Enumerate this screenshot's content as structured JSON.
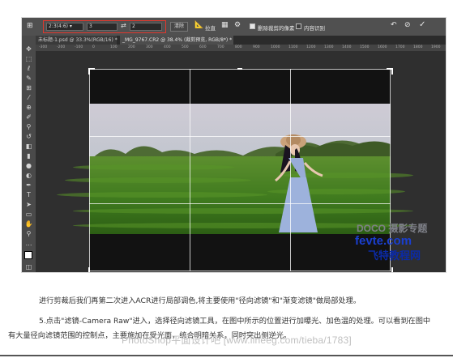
{
  "options_bar": {
    "ratio_label": "2:3(4:6)",
    "ratio_w": "3",
    "swap_symbol": "⇄",
    "ratio_h": "2",
    "clear_label": "清除",
    "straighten_label": "拉直",
    "delete_pixels_label": "删除裁剪的像素",
    "content_aware_label": "内容识别"
  },
  "tabs": [
    {
      "label": "未标题-1.psd @ 33.3%(RGB/16) *"
    },
    {
      "label": "_MG_9767.CR2 @ 38.4% (裁剪预览, RGB/8*) *"
    }
  ],
  "ruler_ticks": [
    "-300",
    "-200",
    "-100",
    "0",
    "100",
    "200",
    "300",
    "400",
    "500",
    "600",
    "700",
    "800",
    "900",
    "1000",
    "1100",
    "1200",
    "1300",
    "1400",
    "1500",
    "1600",
    "1700",
    "1800",
    "1900"
  ],
  "watermark": {
    "line1": "DOCO 摄影专题",
    "line2": "fevte.com",
    "line3": "飞特教程网"
  },
  "article": {
    "p1": "进行剪裁后我们再第二次进入ACR进行局部调色,将主要使用\"径向滤镜\"和\"渐变滤镜\"做局部处理。",
    "p2": "5.点击\"滤镜-Camera Raw\"进入，选择径向滤镜工具，在图中所示的位置进行加曝光、加色温的处理。可以看到在图中",
    "p3": "有大量径向滤镜范围的控制点，主要施加在受光面，统合明暗关系，同时突出侧逆光。",
    "footer_watermark": "PhotoShop平面设计吧 [www.lineeg.com/tieba/1783]"
  },
  "colors": {
    "highlight_box": "#e0382e",
    "watermark_blue": "#1a3fd0"
  }
}
